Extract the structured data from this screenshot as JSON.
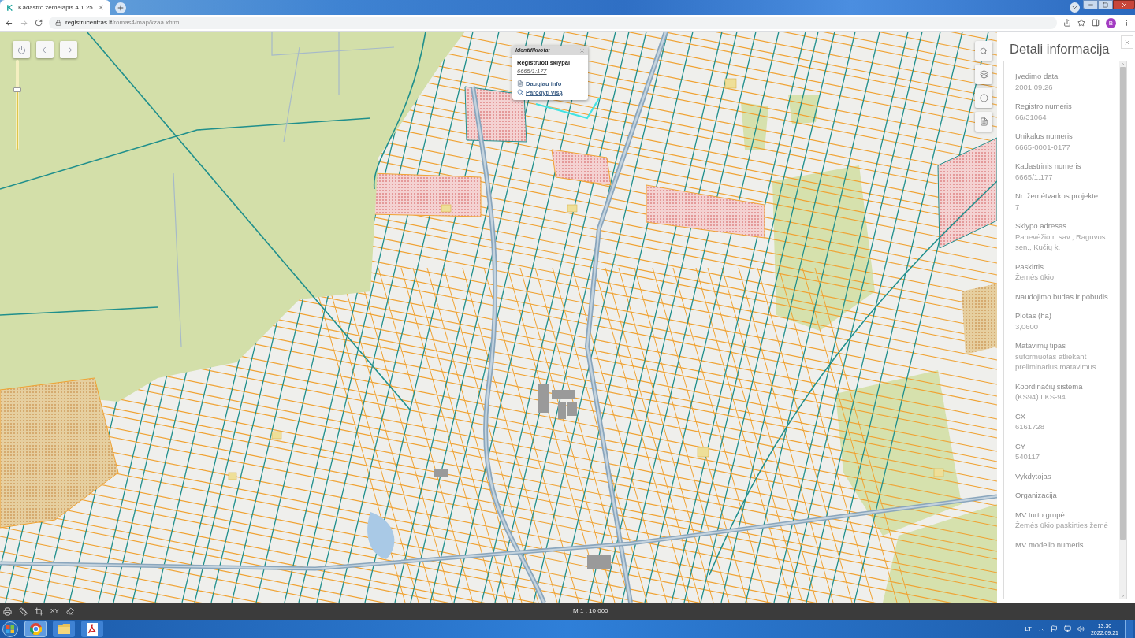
{
  "browser": {
    "tab": {
      "title": "Kadastro žemėlapis 4.1.25"
    },
    "address": {
      "host": "registrucentras.lt",
      "path": "/romas4/map/kzaa.xhtml"
    },
    "forward_disabled": true,
    "profile": {
      "initial": "B"
    }
  },
  "map": {
    "zoom_slider": {
      "level": 0.67
    },
    "popup": {
      "header": "Identifikuota:",
      "layer": "Registruoti sklypai",
      "parcel": "6665/1:177",
      "links": [
        {
          "kind": "info",
          "label": "Daugiau info"
        },
        {
          "kind": "zoom",
          "label": "Parodyti visą"
        }
      ]
    },
    "status_bar": {
      "coordinates_tool": "XY",
      "scale": "M 1 : 10 000"
    }
  },
  "details_panel": {
    "title": "Detali informacija",
    "fields": [
      {
        "label": "Įvedimo data",
        "value": "2001.09.26"
      },
      {
        "label": "Registro numeris",
        "value": "66/31064"
      },
      {
        "label": "Unikalus numeris",
        "value": "6665-0001-0177"
      },
      {
        "label": "Kadastrinis numeris",
        "value": "6665/1:177"
      },
      {
        "label": "Nr. žemėtvarkos projekte",
        "value": "7"
      },
      {
        "label": "Sklypo adresas",
        "value": "Panevėžio r. sav., Raguvos sen., Kučių k."
      },
      {
        "label": "Paskirtis",
        "value": "Žemės ūkio"
      },
      {
        "label": "Naudojimo būdas ir pobūdis"
      },
      {
        "label": "Plotas (ha)",
        "value": "3,0600"
      },
      {
        "label": "Matavimų tipas",
        "value": "suformuotas atliekant preliminarius matavimus"
      },
      {
        "label": "Koordinačių sistema",
        "value": "(KS94) LKS-94"
      },
      {
        "label": "CX",
        "value": "6161728"
      },
      {
        "label": "CY",
        "value": "540117"
      },
      {
        "label": "Vykdytojas"
      },
      {
        "label": "Organizacija"
      },
      {
        "label": "MV turto grupė",
        "value": "Žemės ūkio paskirties žemė"
      },
      {
        "label": "MV modelio numeris"
      }
    ]
  },
  "taskbar": {
    "language": "LT",
    "time": "13:30",
    "date": "2022.09.21"
  }
}
